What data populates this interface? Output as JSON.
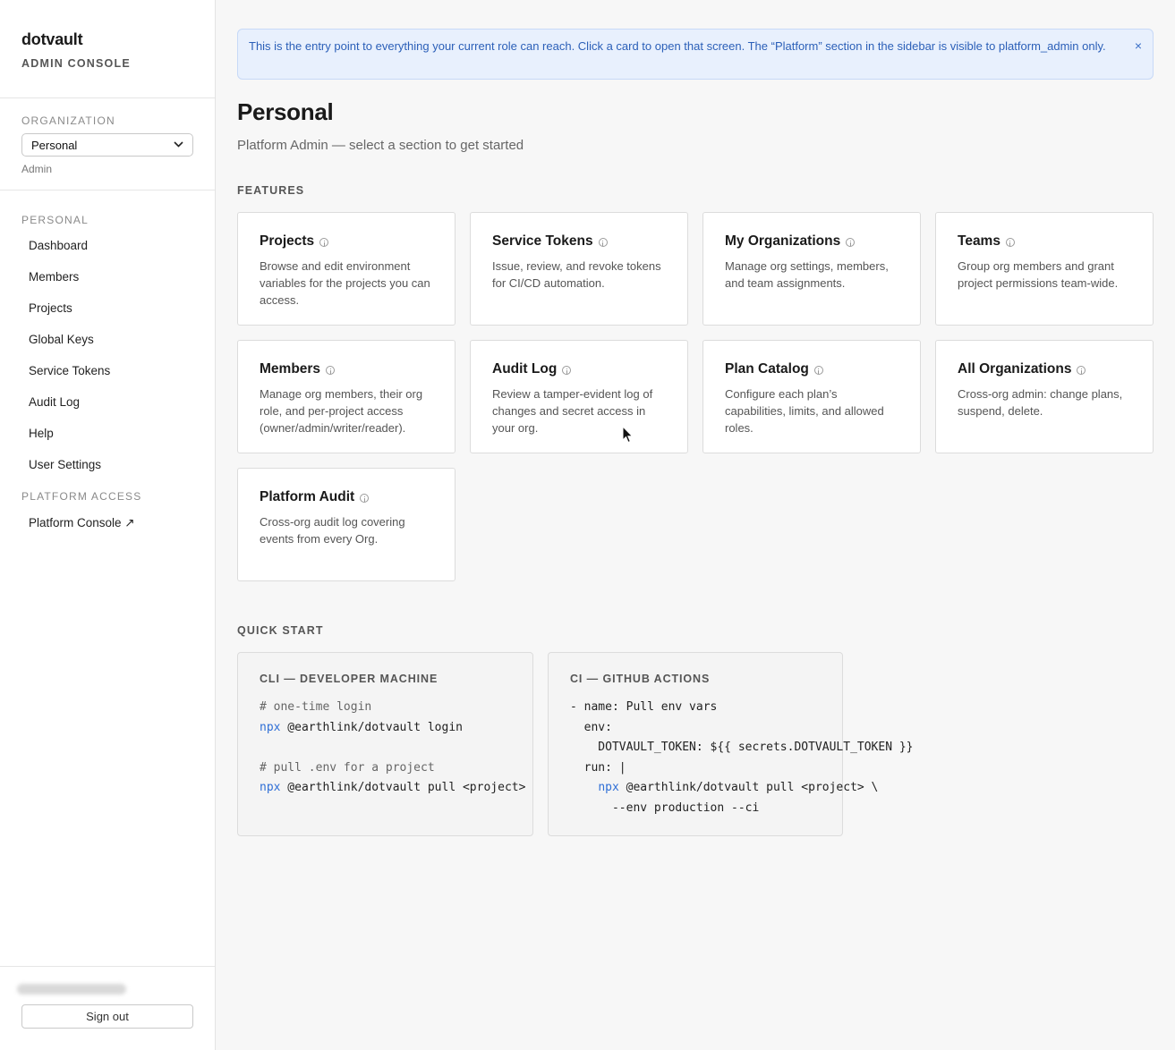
{
  "app": {
    "brand_name": "dotvault",
    "brand_sub": "ADMIN CONSOLE"
  },
  "organization": {
    "label": "ORGANIZATION",
    "selected": "Personal",
    "role": "Admin"
  },
  "nav": {
    "personal_label": "PERSONAL",
    "items": [
      {
        "label": "Dashboard"
      },
      {
        "label": "Members"
      },
      {
        "label": "Projects"
      },
      {
        "label": "Global Keys"
      },
      {
        "label": "Service Tokens"
      },
      {
        "label": "Audit Log"
      },
      {
        "label": "Help"
      },
      {
        "label": "User Settings"
      }
    ],
    "platform_label": "PLATFORM ACCESS",
    "platform_item": "Platform Console ↗"
  },
  "footer": {
    "signout_label": "Sign out"
  },
  "banner": {
    "text": "This is the entry point to everything your current role can reach. Click a card to open that screen. The “Platform” section in the sidebar is visible to platform_admin only.",
    "close": "×"
  },
  "page": {
    "title": "Personal",
    "subtitle": "Platform Admin — select a section to get started"
  },
  "features": {
    "label": "FEATURES",
    "cards": [
      {
        "title": "Projects",
        "desc": "Browse and edit environment variables for the projects you can access."
      },
      {
        "title": "Service Tokens",
        "desc": "Issue, review, and revoke tokens for CI/CD automation."
      },
      {
        "title": "My Organizations",
        "desc": "Manage org settings, members, and team assignments."
      },
      {
        "title": "Teams",
        "desc": "Group org members and grant project permissions team-wide."
      },
      {
        "title": "Members",
        "desc": "Manage org members, their org role, and per-project access (owner/admin/writer/reader)."
      },
      {
        "title": "Audit Log",
        "desc": "Review a tamper-evident log of changes and secret access in your org."
      },
      {
        "title": "Plan Catalog",
        "desc": "Configure each plan’s capabilities, limits, and allowed roles."
      },
      {
        "title": "All Organizations",
        "desc": "Cross-org admin: change plans, suspend, delete."
      },
      {
        "title": "Platform Audit",
        "desc": "Cross-org audit log covering events from every Org."
      }
    ]
  },
  "quick_start": {
    "label": "QUICK START",
    "cli": {
      "title": "CLI — DEVELOPER MACHINE",
      "line1": "# one-time login",
      "line2_kw": "npx",
      "line2_rest": " @earthlink/dotvault login",
      "line3": "# pull .env for a project",
      "line4_kw": "npx",
      "line4_rest": " @earthlink/dotvault pull <project> --"
    },
    "ci": {
      "title": "CI — GITHUB ACTIONS",
      "line1": "- name: Pull env vars",
      "line2": "  env:",
      "line3": "    DOTVAULT_TOKEN: ${{ secrets.DOTVAULT_TOKEN }}",
      "line4": "  run: |",
      "line5_indent": "    ",
      "line5_kw": "npx",
      "line5_rest": " @earthlink/dotvault pull <project> \\",
      "line6": "      --env production --ci"
    }
  }
}
